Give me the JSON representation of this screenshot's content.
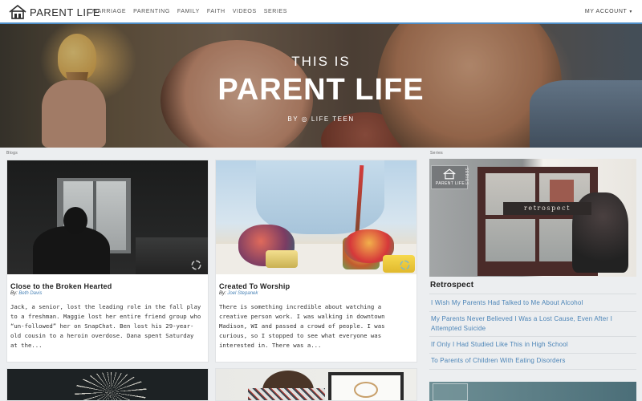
{
  "nav": {
    "brand": "PARENT LIFE",
    "links": [
      "MARRIAGE",
      "PARENTING",
      "FAMILY",
      "FAITH",
      "VIDEOS",
      "SERIES"
    ],
    "account": "MY ACCOUNT",
    "accent_color": "#4f8fc9"
  },
  "hero": {
    "kicker": "THIS IS",
    "title": "PARENT LIFE",
    "byline": "BY ◎ LIFE TEEN"
  },
  "sections": {
    "blogs_label": "Blogs",
    "series_label": "Series"
  },
  "posts": [
    {
      "title": "Close to the Broken Hearted",
      "by_prefix": "By:",
      "author": "Beth Davis",
      "excerpt": "Jack, a senior, lost the leading role in the fall play to a freshman. Maggie lost her entire friend group who “un-followed” her on SnapChat. Ben lost his 29-year-old cousin to a heroin overdose. Dana spent Saturday at the..."
    },
    {
      "title": "Created To Worship",
      "by_prefix": "By:",
      "author": "Joel Stepanek",
      "excerpt": "There is something incredible about watching a creative person work. I was walking in downtown Madison, WI and passed a crowd of people. I was curious, so I stopped to see what everyone was interested in. There was a..."
    }
  ],
  "series": {
    "badge_text": "PARENT LIFE",
    "side_word": "SERIES",
    "image_word": "retrospect",
    "title": "Retrospect",
    "links": [
      "I Wish My Parents Had Talked to Me About Alcohol",
      "My Parents Never Believed I Was a Lost Cause, Even After I Attempted Suicide",
      "If Only I Had Studied Like This in High School",
      "To Parents of Children With Eating Disorders"
    ],
    "link_color": "#4b84b7"
  }
}
